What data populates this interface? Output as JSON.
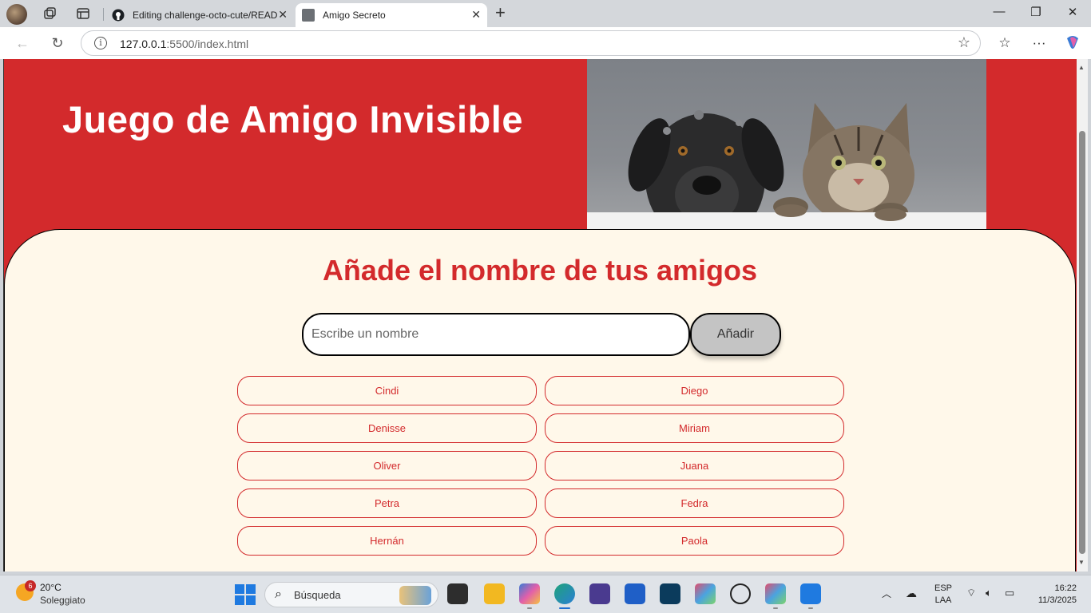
{
  "browser": {
    "tabs": [
      {
        "title": "Editing challenge-octo-cute/READ",
        "active": false
      },
      {
        "title": "Amigo Secreto",
        "active": true
      }
    ],
    "url": {
      "host": "127.0.0.1",
      "path": ":5500/index.html"
    }
  },
  "page": {
    "hero_title": "Juego de Amigo Invisible",
    "section_title": "Añade el nombre de tus amigos",
    "input_placeholder": "Escribe un nombre",
    "add_button": "Añadir",
    "friends": [
      "Cindi",
      "Diego",
      "Denisse",
      "Miriam",
      "Oliver",
      "Juana",
      "Petra",
      "Fedra",
      "Hernán",
      "Paola"
    ],
    "colors": {
      "brand_red": "#d32a2c",
      "cream": "#fff8ea",
      "button_gray": "#c4c4c4"
    }
  },
  "taskbar": {
    "weather": {
      "badge": "6",
      "temp": "20°C",
      "desc": "Soleggiato"
    },
    "search_placeholder": "Búsqueda",
    "lang": {
      "line1": "ESP",
      "line2": "LAA"
    },
    "clock": {
      "time": "16:22",
      "date": "11/3/2025"
    }
  }
}
